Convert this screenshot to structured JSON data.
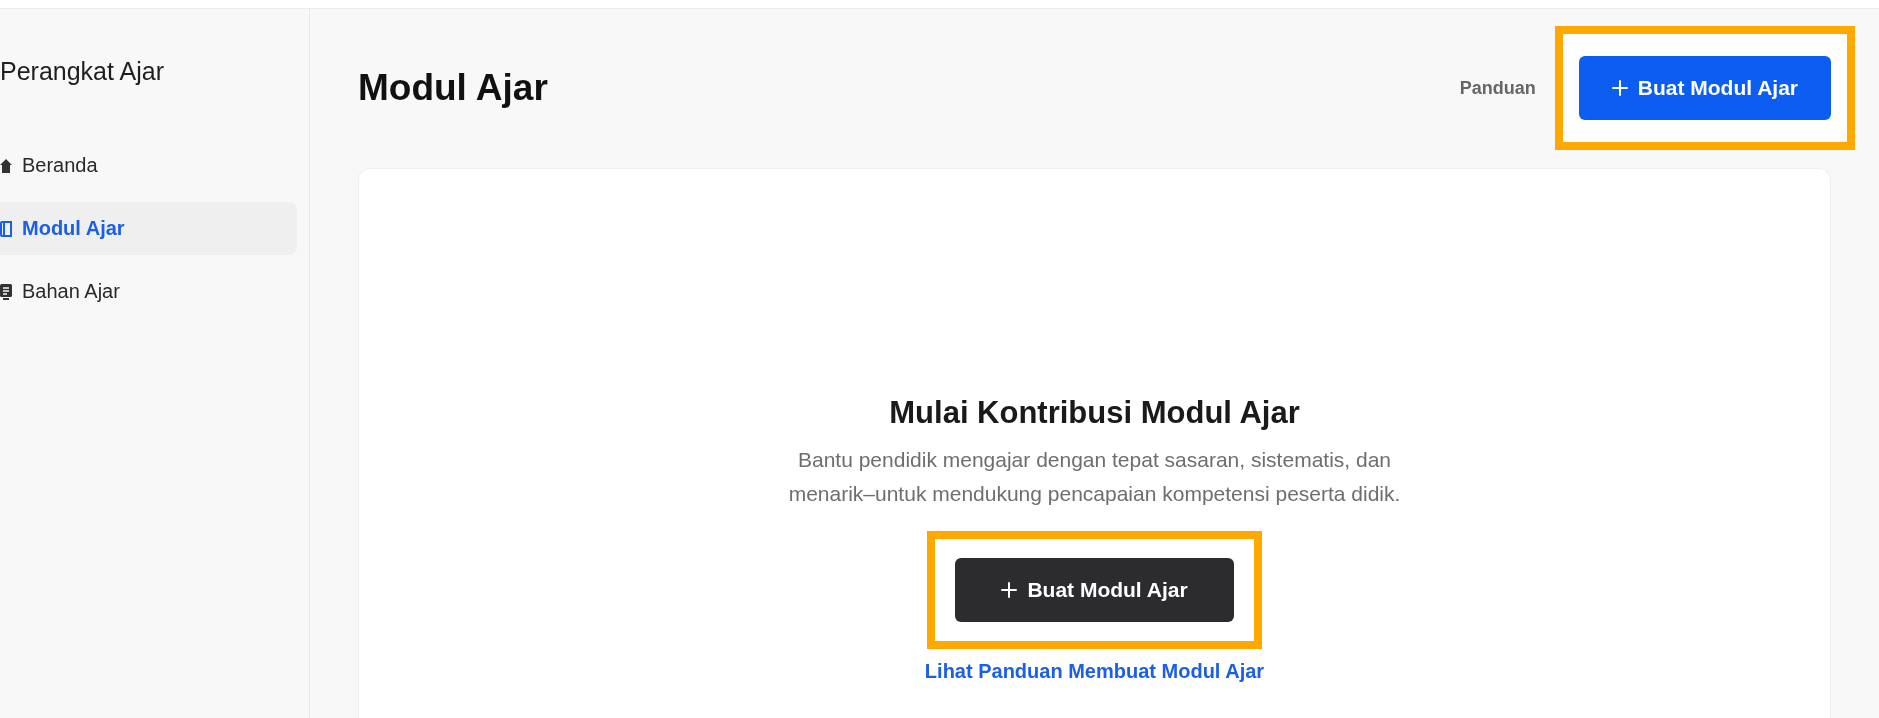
{
  "sidebar": {
    "title": "Perangkat Ajar",
    "items": [
      {
        "label": "Beranda",
        "selected": false
      },
      {
        "label": "Modul Ajar",
        "selected": true
      },
      {
        "label": "Bahan Ajar",
        "selected": false
      }
    ]
  },
  "header": {
    "title": "Modul Ajar",
    "guide_link": "Panduan",
    "create_button": {
      "label": "Buat Modul Ajar",
      "highlighted": true
    }
  },
  "empty_state": {
    "title": "Mulai Kontribusi Modul Ajar",
    "description": "Bantu pendidik mengajar dengan tepat sasaran, sistematis, dan menarik–untuk mendukung pencapaian kompetensi peserta didik.",
    "create_button": {
      "label": "Buat Modul Ajar",
      "highlighted": true
    },
    "guide_link": "Lihat Panduan Membuat Modul Ajar"
  }
}
